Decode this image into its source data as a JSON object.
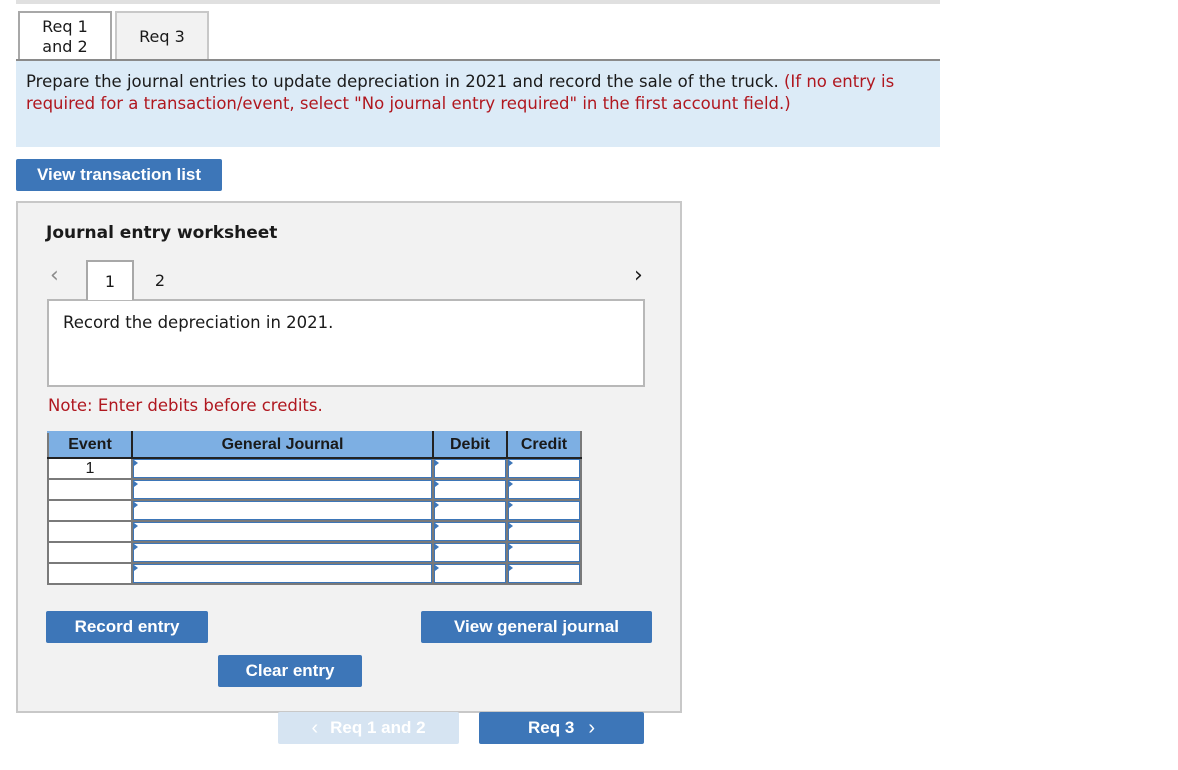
{
  "tabs": [
    {
      "label_line1": "Req 1",
      "label_line2": "and 2",
      "active": true
    },
    {
      "label": "Req 3",
      "active": false
    }
  ],
  "instructions": {
    "main": "Prepare the journal entries to update depreciation in 2021 and record the sale of the truck.",
    "note": "(If no entry is required for a transaction/event, select \"No journal entry required\" in the first account field.)"
  },
  "view_transaction_list_label": "View transaction list",
  "worksheet": {
    "title": "Journal entry worksheet",
    "prev_icon": "‹",
    "next_icon": "›",
    "entry_tabs": [
      "1",
      "2"
    ],
    "active_entry": "1",
    "description": "Record the depreciation in 2021.",
    "note": "Note: Enter debits before credits.",
    "table": {
      "headers": [
        "Event",
        "General Journal",
        "Debit",
        "Credit"
      ],
      "rows": [
        {
          "event": "1",
          "account": "",
          "debit": "",
          "credit": ""
        },
        {
          "event": "",
          "account": "",
          "debit": "",
          "credit": ""
        },
        {
          "event": "",
          "account": "",
          "debit": "",
          "credit": ""
        },
        {
          "event": "",
          "account": "",
          "debit": "",
          "credit": ""
        },
        {
          "event": "",
          "account": "",
          "debit": "",
          "credit": ""
        },
        {
          "event": "",
          "account": "",
          "debit": "",
          "credit": ""
        }
      ]
    },
    "record_entry_label": "Record entry",
    "clear_entry_label": "Clear entry",
    "view_general_journal_label": "View general journal"
  },
  "bottom_nav": {
    "prev_label": "Req 1 and 2",
    "next_label": "Req 3",
    "prev_icon": "‹",
    "next_icon": "›"
  },
  "colors": {
    "accent": "#3d76b8",
    "header_blue": "#7dafe3",
    "instruction_bg": "#dcebf7",
    "alert_red": "#b0171f"
  }
}
